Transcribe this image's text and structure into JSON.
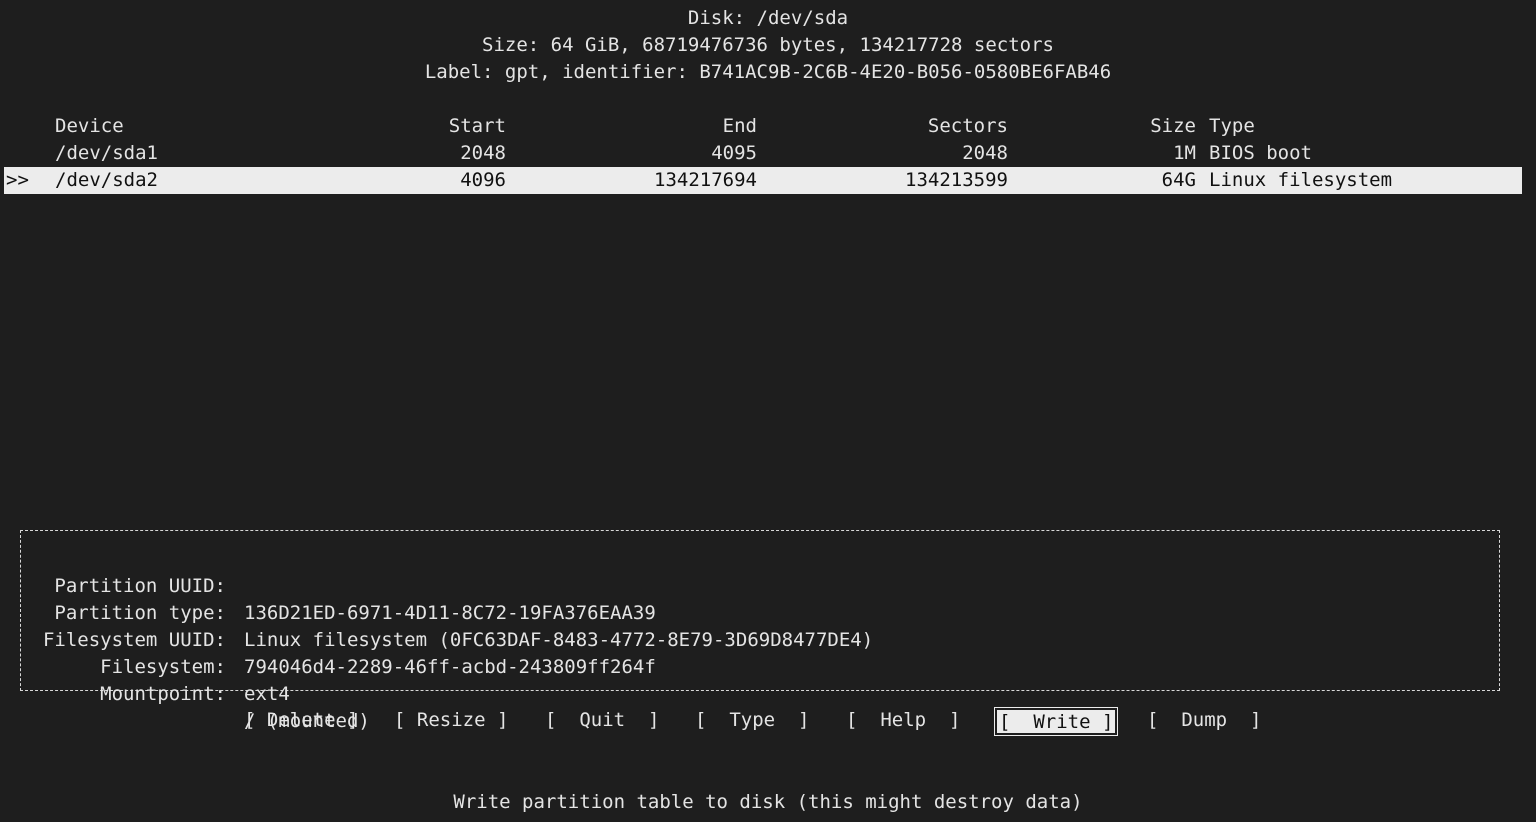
{
  "header": {
    "disk": "Disk: /dev/sda",
    "size": "Size: 64 GiB, 68719476736 bytes, 134217728 sectors",
    "label": "Label: gpt, identifier: B741AC9B-2C6B-4E20-B056-0580BE6FAB46"
  },
  "table": {
    "columns": {
      "device": "Device",
      "start": "Start",
      "end": "End",
      "sectors": "Sectors",
      "size": "Size",
      "type": "Type"
    },
    "rows": [
      {
        "marker": "",
        "device": "/dev/sda1",
        "start": "2048",
        "end": "4095",
        "sectors": "2048",
        "size": "1M",
        "type": "BIOS boot"
      },
      {
        "marker": ">>",
        "device": "/dev/sda2",
        "start": "4096",
        "end": "134217694",
        "sectors": "134213599",
        "size": "64G",
        "type": "Linux filesystem"
      }
    ]
  },
  "info": {
    "partition_uuid": {
      "label": "Partition UUID:",
      "value": "136D21ED-6971-4D11-8C72-19FA376EAA39"
    },
    "partition_type": {
      "label": "Partition type:",
      "value": "Linux filesystem (0FC63DAF-8483-4772-8E79-3D69D8477DE4)"
    },
    "filesystem_uuid": {
      "label": "Filesystem UUID:",
      "value": "794046d4-2289-46ff-acbd-243809ff264f"
    },
    "filesystem": {
      "label": "Filesystem:",
      "value": "ext4"
    },
    "mountpoint": {
      "label": "Mountpoint:",
      "value": "/ (mounted)"
    }
  },
  "menu": {
    "delete": "[ Delete ]",
    "resize": "[ Resize ]",
    "quit": "[  Quit  ]",
    "type": "[  Type  ]",
    "help": "[  Help  ]",
    "write": "[  Write ]",
    "dump": "[  Dump  ]",
    "selected": "write"
  },
  "status": "Write partition table to disk (this might destroy data)",
  "colors": {
    "background": "#1e1e1e",
    "foreground": "#e4e4e4",
    "highlight_bg": "#ececec",
    "highlight_fg": "#111111"
  }
}
